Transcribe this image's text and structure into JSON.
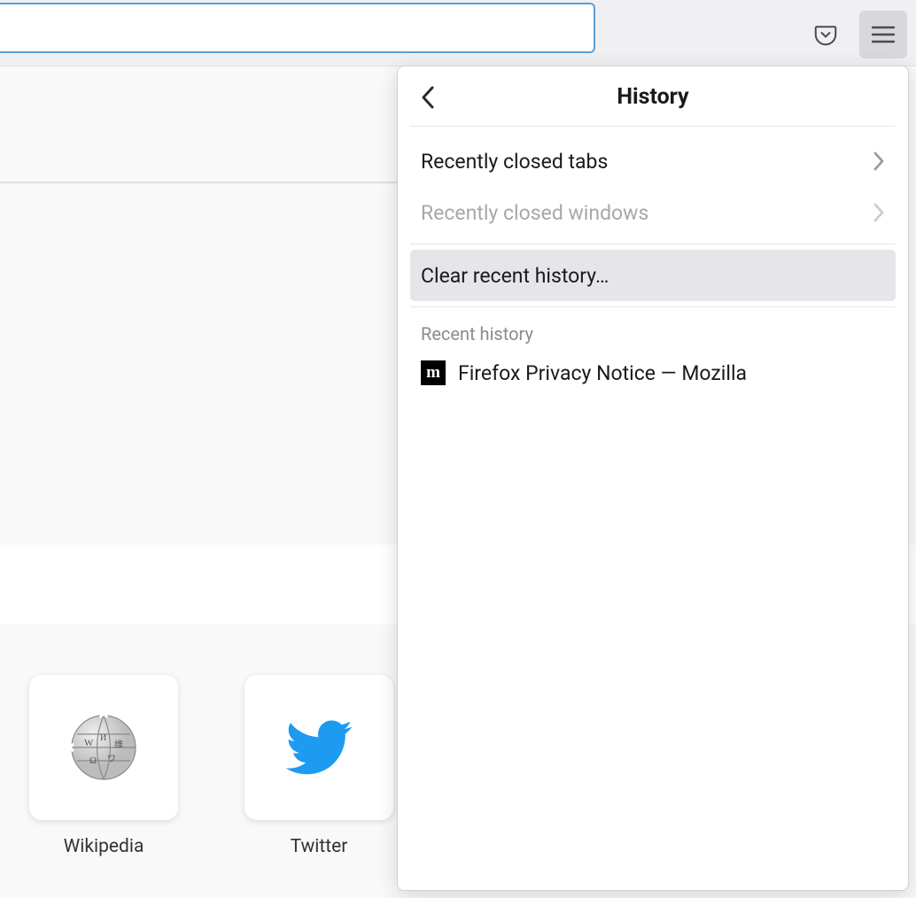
{
  "toolbar": {
    "urlValue": ""
  },
  "historyPanel": {
    "title": "History",
    "recentlyClosedTabs": "Recently closed tabs",
    "recentlyClosedWindows": "Recently closed windows",
    "clearRecentHistory": "Clear recent history…",
    "sectionHeader": "Recent history",
    "historyItems": [
      {
        "title": "Firefox Privacy Notice — Mozilla",
        "iconLetter": "m"
      }
    ]
  },
  "topsites": [
    {
      "label": "Wikipedia",
      "icon": "wikipedia"
    },
    {
      "label": "Twitter",
      "icon": "twitter"
    }
  ]
}
